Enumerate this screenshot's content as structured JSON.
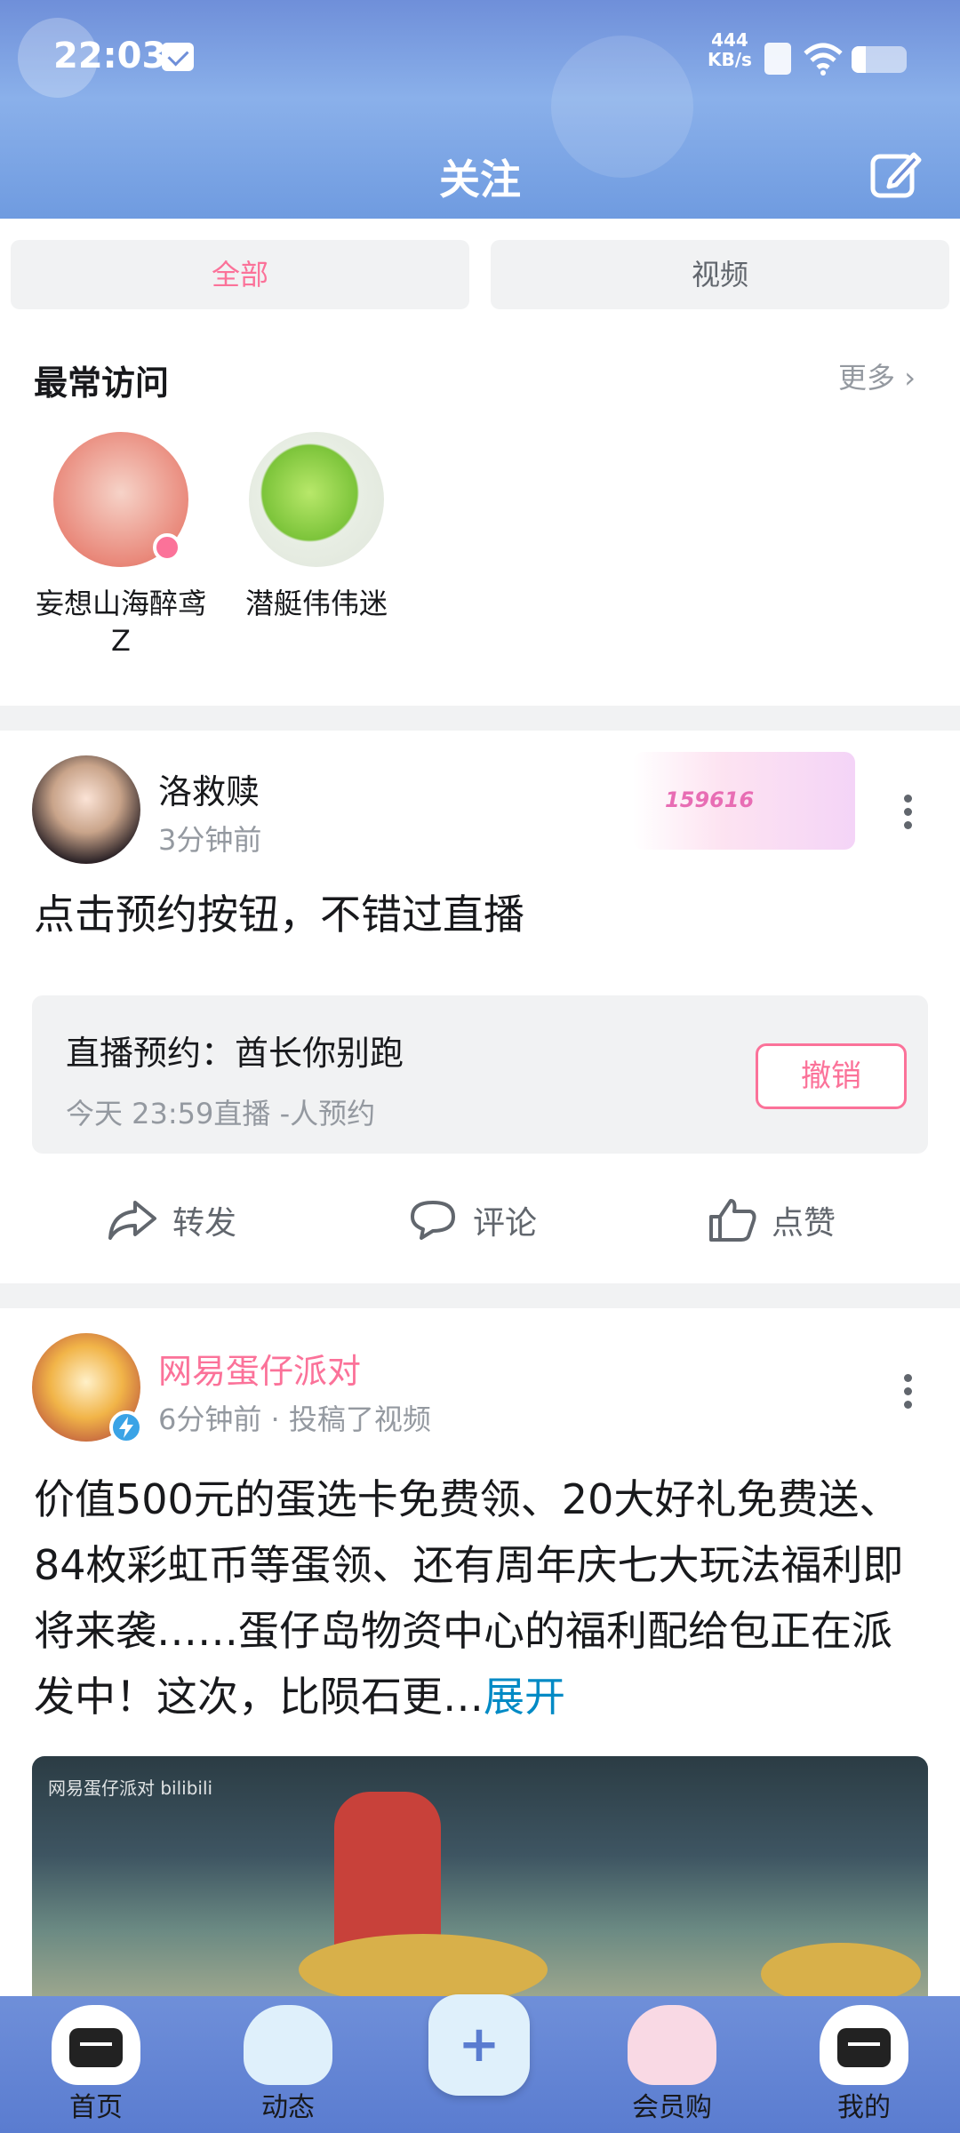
{
  "status_bar": {
    "time": "22:03",
    "net_speed_value": "444",
    "net_speed_unit": "KB/s"
  },
  "header": {
    "title": "关注"
  },
  "tabs": [
    {
      "label": "全部",
      "active": true
    },
    {
      "label": "视频",
      "active": false
    }
  ],
  "frequent": {
    "title": "最常访问",
    "more_label": "更多 ›",
    "users": [
      {
        "name": "妄想山海醉鸢Z",
        "live": true
      },
      {
        "name": "潜艇伟伟迷",
        "live": false
      }
    ]
  },
  "post1": {
    "author": "洛救赎",
    "time": "3分钟前",
    "badge_number": "159616",
    "text": "点击预约按钮，不错过直播",
    "live_card": {
      "title": "直播预约：酋长你别跑",
      "subtitle": "今天 23:59直播   -人预约",
      "button_label": "撤销"
    },
    "actions": {
      "share": "转发",
      "comment": "评论",
      "like": "点赞"
    }
  },
  "post2": {
    "author": "网易蛋仔派对",
    "meta": "6分钟前 · 投稿了视频",
    "text": "价值500元的蛋选卡免费领、20大好礼免费送、84枚彩虹币等蛋领、还有周年庆七大玩法福利即将来袭……蛋仔岛物资中心的福利配给包正在派发中！这次，比陨石更…",
    "expand_label": "展开",
    "cover_watermark": "网易蛋仔派对 bilibili"
  },
  "bottom_nav": [
    {
      "label": "首页"
    },
    {
      "label": "动态"
    },
    {
      "label": "+"
    },
    {
      "label": "会员购"
    },
    {
      "label": "我的"
    }
  ],
  "colors": {
    "accent_pink": "#fb7299",
    "link_blue": "#008ac5",
    "header_blue": "#6f8fd9"
  }
}
